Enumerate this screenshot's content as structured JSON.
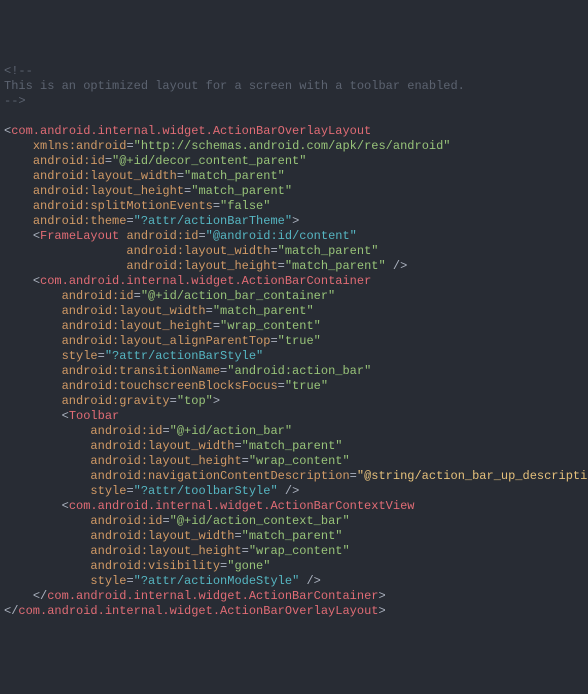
{
  "comment": {
    "l1": "<!--",
    "l2": "This is an optimized layout for a screen with a toolbar enabled.",
    "l3": "-->"
  },
  "root": {
    "tag": "com.android.internal.widget.ActionBarOverlayLayout",
    "xmlns_name": "xmlns:android",
    "xmlns_val": "\"http://schemas.android.com/apk/res/android\"",
    "id_name": "android:id",
    "id_val": "\"@+id/decor_content_parent\"",
    "lw_name": "android:layout_width",
    "lw_val": "\"match_parent\"",
    "lh_name": "android:layout_height",
    "lh_val": "\"match_parent\"",
    "sm_name": "android:splitMotionEvents",
    "sm_val": "\"false\"",
    "th_name": "android:theme",
    "th_val": "\"?attr/actionBarTheme\""
  },
  "frame": {
    "tag": "FrameLayout",
    "id_name": "android:id",
    "id_val": "\"@android:id/content\"",
    "lw_name": "android:layout_width",
    "lw_val": "\"match_parent\"",
    "lh_name": "android:layout_height",
    "lh_val": "\"match_parent\""
  },
  "container": {
    "tag": "com.android.internal.widget.ActionBarContainer",
    "id_name": "android:id",
    "id_val": "\"@+id/action_bar_container\"",
    "lw_name": "android:layout_width",
    "lw_val": "\"match_parent\"",
    "lh_name": "android:layout_height",
    "lh_val": "\"wrap_content\"",
    "apt_name": "android:layout_alignParentTop",
    "apt_val": "\"true\"",
    "st_name": "style",
    "st_val": "\"?attr/actionBarStyle\"",
    "tn_name": "android:transitionName",
    "tn_val": "\"android:action_bar\"",
    "tbf_name": "android:touchscreenBlocksFocus",
    "tbf_val": "\"true\"",
    "gr_name": "android:gravity",
    "gr_val": "\"top\""
  },
  "toolbar": {
    "tag": "Toolbar",
    "id_name": "android:id",
    "id_val": "\"@+id/action_bar\"",
    "lw_name": "android:layout_width",
    "lw_val": "\"match_parent\"",
    "lh_name": "android:layout_height",
    "lh_val": "\"wrap_content\"",
    "ncd_name": "android:navigationContentDescription",
    "ncd_val": "\"@string/action_bar_up_description\"",
    "st_name": "style",
    "st_val": "\"?attr/toolbarStyle\""
  },
  "ctx": {
    "tag": "com.android.internal.widget.ActionBarContextView",
    "id_name": "android:id",
    "id_val": "\"@+id/action_context_bar\"",
    "lw_name": "android:layout_width",
    "lw_val": "\"match_parent\"",
    "lh_name": "android:layout_height",
    "lh_val": "\"wrap_content\"",
    "vis_name": "android:visibility",
    "vis_val": "\"gone\"",
    "st_name": "style",
    "st_val": "\"?attr/actionModeStyle\""
  }
}
